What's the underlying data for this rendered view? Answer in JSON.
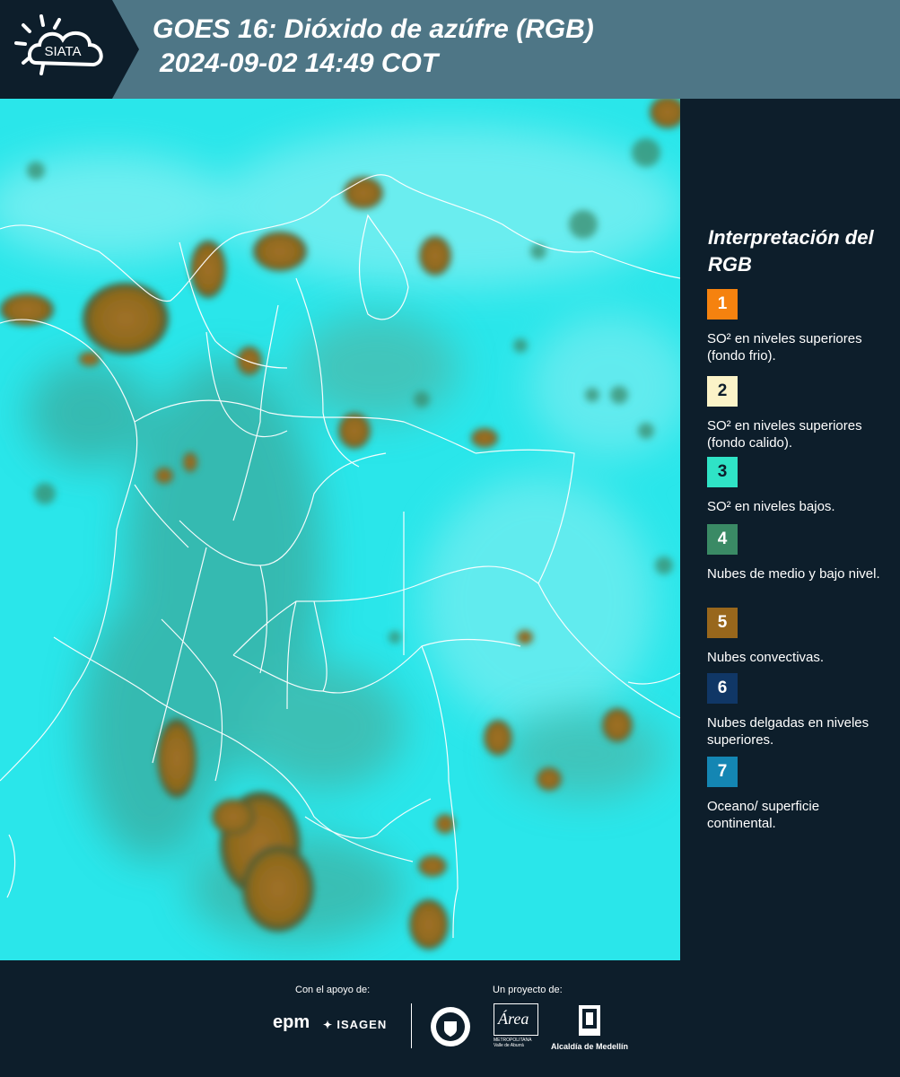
{
  "header": {
    "logo_text": "SIATA",
    "title_line1": "GOES 16: Dióxido de azúfre (RGB)",
    "title_line2": "2024-09-02 14:49 COT"
  },
  "legend": {
    "title": "Interpretación del RGB",
    "items": [
      {
        "number": "1",
        "color": "#f5820f",
        "text": "SO² en niveles superiores (fondo frio)."
      },
      {
        "number": "2",
        "color": "#fbf3c8",
        "text": "SO² en niveles superiores (fondo calido)."
      },
      {
        "number": "3",
        "color": "#2fe3c6",
        "text": "SO² en niveles bajos."
      },
      {
        "number": "4",
        "color": "#3a8a65",
        "text": "Nubes de medio y bajo nivel."
      },
      {
        "number": "5",
        "color": "#98671c",
        "text": "Nubes convectivas."
      },
      {
        "number": "6",
        "color": "#103766",
        "text": "Nubes delgadas en niveles superiores."
      },
      {
        "number": "7",
        "color": "#1486b3",
        "text": "Oceano/ superficie continental."
      }
    ]
  },
  "footer": {
    "support_label": "Con el apoyo de:",
    "project_label": "Un proyecto de:",
    "epm": "epm",
    "isagen": "ISAGEN",
    "area_text": "Área",
    "area_sub1": "METROPOLITANA",
    "area_sub2": "Valle de Aburrá",
    "alcaldia": "Alcaldía de Medellín"
  },
  "colors": {
    "header_bg": "#4e7686",
    "dark_bg": "#0d1e2b",
    "map_cyan": "#2ae8ea",
    "cloud_brown": "#98671c",
    "cloud_green": "#3f9c8c"
  }
}
